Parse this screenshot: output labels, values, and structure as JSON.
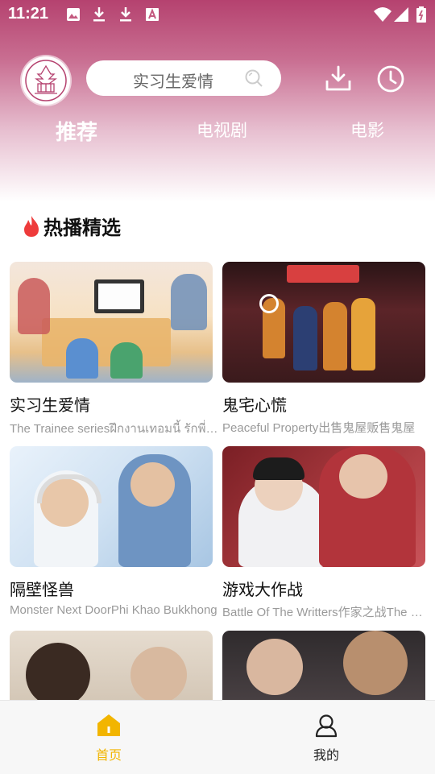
{
  "status_bar": {
    "time": "11:21",
    "left_icons": [
      "image-icon",
      "download-icon",
      "download-icon",
      "text-a-icon"
    ],
    "right_icons": [
      "wifi-icon",
      "signal-icon",
      "battery-icon"
    ]
  },
  "header": {
    "search_text": "实习生爱情",
    "icons": [
      "search-icon",
      "download-icon",
      "history-clock-icon"
    ]
  },
  "tabs": [
    {
      "label": "推荐",
      "active": true
    },
    {
      "label": "电视剧",
      "active": false
    },
    {
      "label": "电影",
      "active": false
    }
  ],
  "section": {
    "title": "热播精选",
    "icon": "flame-icon",
    "items": [
      {
        "title": "实习生爱情",
        "subtitle": "The Trainee seriesฝึกงานเทอมนี้ รักพี่ได้มั้ย"
      },
      {
        "title": "鬼宅心慌",
        "subtitle": "Peaceful Property出售鬼屋贩售鬼屋"
      },
      {
        "title": "隔壁怪兽",
        "subtitle": "Monster Next DoorPhi Khao Bukkhong"
      },
      {
        "title": "游戏大作战",
        "subtitle": "Battle Of The Writters作家之战The Writers"
      },
      {
        "title": "",
        "subtitle": ""
      },
      {
        "title": "",
        "subtitle": ""
      }
    ]
  },
  "bottom_nav": [
    {
      "label": "首页",
      "icon": "home-icon",
      "active": true,
      "color": "#f2b500"
    },
    {
      "label": "我的",
      "icon": "user-icon",
      "active": false,
      "color": "#222222"
    }
  ],
  "colors": {
    "accent": "#f2b500",
    "header_gradient_top": "#b5426f",
    "flame": "#ee3b3b"
  }
}
